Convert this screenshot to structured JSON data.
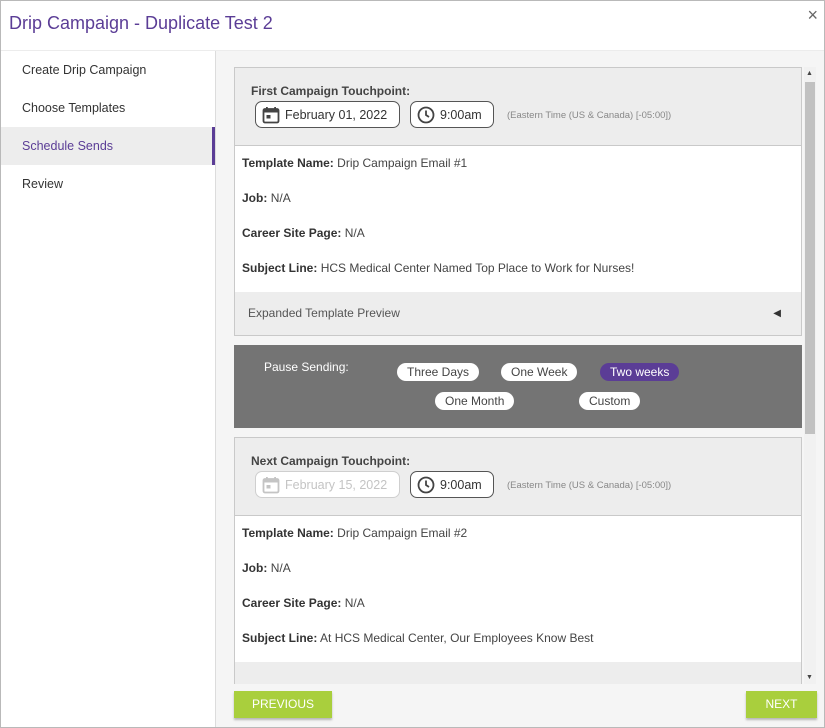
{
  "dialog": {
    "title": "Drip Campaign - Duplicate Test 2",
    "close_glyph": "×"
  },
  "sidebar": {
    "items": [
      {
        "label": "Create Drip Campaign"
      },
      {
        "label": "Choose Templates"
      },
      {
        "label": "Schedule Sends",
        "active": true
      },
      {
        "label": "Review"
      }
    ]
  },
  "first_touchpoint": {
    "label": "First Campaign Touchpoint:",
    "date": "February 01, 2022",
    "time": "9:00am",
    "timezone": "(Eastern Time (US & Canada) [-05:00])",
    "template_name_label": "Template Name:",
    "template_name": "Drip Campaign Email #1",
    "job_label": "Job:",
    "job": "N/A",
    "career_site_label": "Career Site Page:",
    "career_site": "N/A",
    "subject_label": "Subject Line:",
    "subject": "HCS Medical Center Named Top Place to Work for Nurses!",
    "preview_label": "Expanded Template Preview"
  },
  "pause": {
    "label": "Pause Sending:",
    "options": [
      {
        "label": "Three Days"
      },
      {
        "label": "One Week"
      },
      {
        "label": "Two weeks",
        "selected": true
      },
      {
        "label": "One Month"
      },
      {
        "label": "Custom"
      }
    ]
  },
  "next_touchpoint": {
    "label": "Next Campaign Touchpoint:",
    "date": "February 15, 2022",
    "time": "9:00am",
    "timezone": "(Eastern Time (US & Canada) [-05:00])",
    "template_name_label": "Template Name:",
    "template_name": "Drip Campaign Email #2",
    "job_label": "Job:",
    "job": "N/A",
    "career_site_label": "Career Site Page:",
    "career_site": "N/A",
    "subject_label": "Subject Line:",
    "subject": "At HCS Medical Center, Our Employees Know Best"
  },
  "footer": {
    "previous_label": "PREVIOUS",
    "next_label": "NEXT"
  },
  "colors": {
    "accent": "#5b3d96",
    "button": "#a9cf3d",
    "pause_bg": "#747474"
  },
  "icons": {
    "date": "calendar-icon",
    "time": "clock-icon",
    "collapse": "caret-left-icon"
  }
}
